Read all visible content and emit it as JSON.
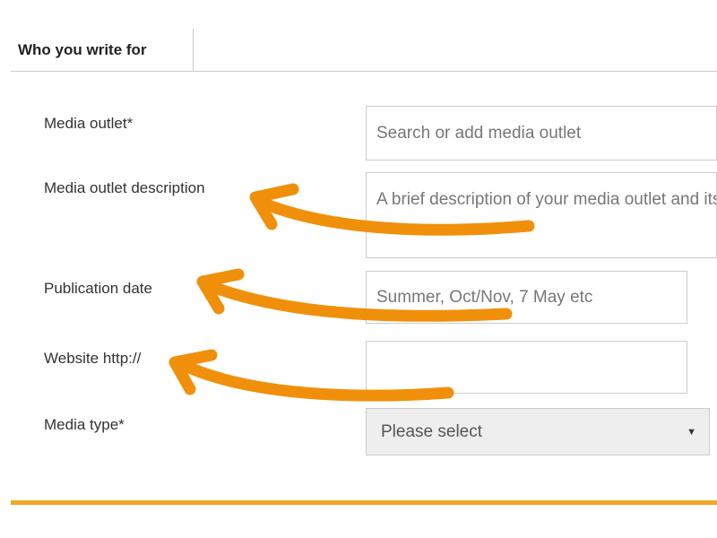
{
  "tab": {
    "label": "Who you write for"
  },
  "form": {
    "media_outlet": {
      "label": "Media outlet*",
      "placeholder": "Search or add media outlet"
    },
    "description": {
      "label": "Media outlet description",
      "placeholder": "A brief description of your media outlet and its readership helps respondents pitch appropriately"
    },
    "publication_date": {
      "label": "Publication date",
      "placeholder": "Summer, Oct/Nov, 7 May etc"
    },
    "website": {
      "label": "Website http://",
      "value": ""
    },
    "media_type": {
      "label": "Media type*",
      "selected": "Please select",
      "arrow": "▼"
    }
  },
  "colors": {
    "accent": "#f5a623",
    "annotation_arrow": "#f0900a"
  },
  "annotations": {
    "arrow_icon_name": "curved-arrow-icon"
  }
}
